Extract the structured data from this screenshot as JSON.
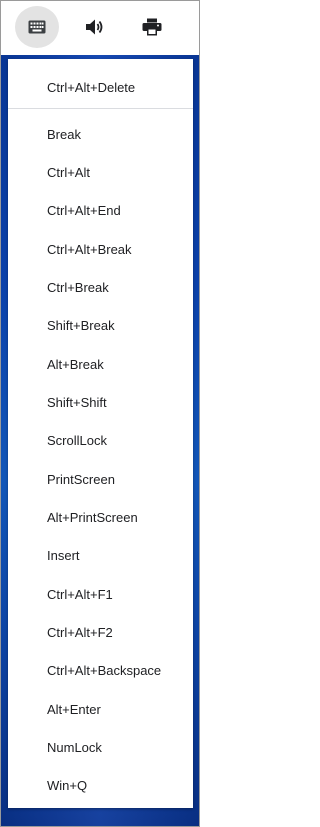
{
  "toolbar": {
    "buttons": [
      {
        "icon": "keyboard-icon",
        "active": true
      },
      {
        "icon": "speaker-icon",
        "active": false
      },
      {
        "icon": "printer-icon",
        "active": false
      }
    ],
    "active_color": "#e3e3e3",
    "icon_color": "#202124"
  },
  "menu": {
    "top_item": "Ctrl+Alt+Delete",
    "items": [
      "Break",
      "Ctrl+Alt",
      "Ctrl+Alt+End",
      "Ctrl+Alt+Break",
      "Ctrl+Break",
      "Shift+Break",
      "Alt+Break",
      "Shift+Shift",
      "ScrollLock",
      "PrintScreen",
      "Alt+PrintScreen",
      "Insert",
      "Ctrl+Alt+F1",
      "Ctrl+Alt+F2",
      "Ctrl+Alt+Backspace",
      "Alt+Enter",
      "NumLock",
      "Win+Q"
    ]
  }
}
